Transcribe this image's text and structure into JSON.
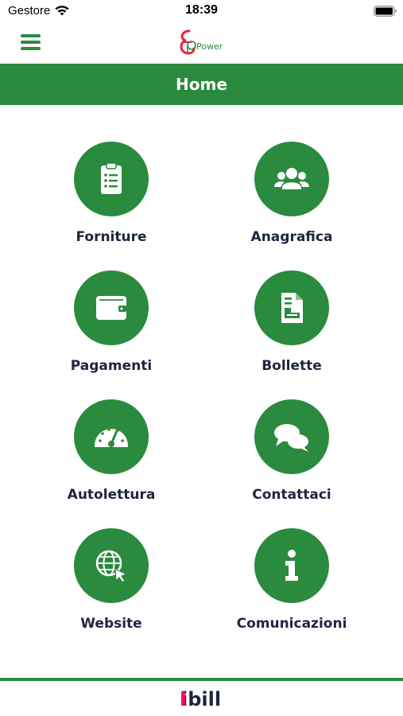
{
  "status_bar": {
    "carrier": "Gestore",
    "time": "18:39",
    "wifi_icon": "wifi-icon",
    "battery_icon": "battery-icon"
  },
  "nav_bar": {
    "menu_icon": "hamburger-menu-icon",
    "logo_text": "Power",
    "logo_colors": {
      "mark": "#e3263b",
      "text": "#2a8a3e"
    }
  },
  "header": {
    "title": "Home"
  },
  "tiles": [
    {
      "label": "Forniture",
      "icon": "clipboard-list-icon"
    },
    {
      "label": "Anagrafica",
      "icon": "users-icon"
    },
    {
      "label": "Pagamenti",
      "icon": "wallet-icon"
    },
    {
      "label": "Bollette",
      "icon": "bill-document-icon"
    },
    {
      "label": "Autolettura",
      "icon": "gauge-icon"
    },
    {
      "label": "Contattaci",
      "icon": "chat-bubbles-icon"
    },
    {
      "label": "Website",
      "icon": "globe-cursor-icon"
    },
    {
      "label": "Comunicazioni",
      "icon": "info-icon"
    }
  ],
  "footer": {
    "logo_text": "ibill",
    "logo_colors": {
      "i": "#e3146b",
      "bill": "#1d2540"
    }
  },
  "colors": {
    "brand_green": "#2a8a3e",
    "label_text": "#1d2540",
    "header_text": "#ffffff"
  }
}
